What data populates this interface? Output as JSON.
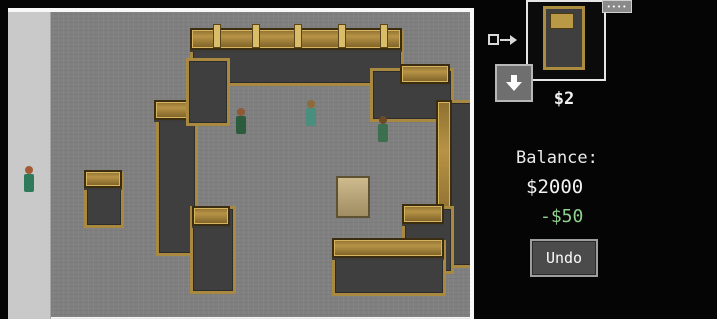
{
  "game": {
    "title": "",
    "scene": {
      "entities": [
        {
          "kind": "visitor",
          "shirt": "#2f7a5a",
          "head": "#a35b35"
        },
        {
          "kind": "visitor",
          "shirt": "#4a8e7e",
          "head": "#8c5a35"
        },
        {
          "kind": "visitor",
          "shirt": "#3b6f4d",
          "head": "#8c6a3a"
        },
        {
          "kind": "visitor",
          "shirt": "#2d5b3d",
          "head": "#6b4a27"
        }
      ]
    }
  },
  "panel": {
    "selected_item_price": "$2",
    "menu_icon": "dots-icon",
    "arrow_icon": "arrow-right-icon",
    "down_icon": "arrow-down-icon",
    "balance_label": "Balance:",
    "balance_value": "$2000",
    "pending_cost": "-$50",
    "undo_label": "Undo"
  },
  "colors": {
    "wall_gold": "#b79346",
    "floor_gray": "#808080",
    "cost_green": "#8fd08f"
  }
}
